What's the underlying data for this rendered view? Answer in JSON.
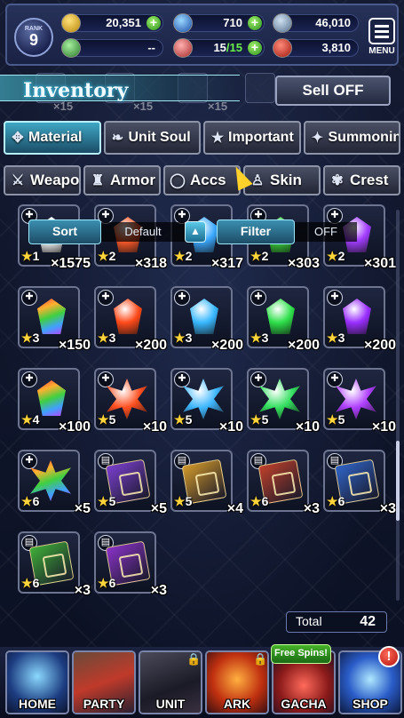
{
  "status_bar": {
    "rank_label": "RANK",
    "rank_value": "9",
    "gil": "20,351",
    "lapis": "710",
    "currency3": "46,010",
    "friend": "--",
    "energy_current": "15",
    "energy_max": "/15",
    "arena": "3,810",
    "menu_label": "MENU"
  },
  "header": {
    "title": "Inventory",
    "sell_label": "Sell OFF",
    "ghost_qty": "×15"
  },
  "tabs": {
    "row1": [
      "Material",
      "Unit Soul",
      "Important",
      "Summoning"
    ],
    "row2": [
      "Weapon",
      "Armor",
      "Accs",
      "Skin",
      "Crest"
    ],
    "active": "Material"
  },
  "sort_filter": {
    "sort_label": "Sort",
    "sort_value": "Default",
    "filter_label": "Filter",
    "filter_value": "OFF"
  },
  "items": [
    {
      "stars": "1",
      "qty": "×1575",
      "kind": "gem",
      "color": "#ffffff"
    },
    {
      "stars": "2",
      "qty": "×318",
      "kind": "gem",
      "color": "#ff5a2a"
    },
    {
      "stars": "2",
      "qty": "×317",
      "kind": "gem",
      "color": "#3aa8ff"
    },
    {
      "stars": "2",
      "qty": "×303",
      "kind": "gem",
      "color": "#39d13b"
    },
    {
      "stars": "2",
      "qty": "×301",
      "kind": "gem",
      "color": "#a23cff"
    },
    {
      "stars": "3",
      "qty": "×150",
      "kind": "gem",
      "color": "rainbow"
    },
    {
      "stars": "3",
      "qty": "×200",
      "kind": "gem",
      "color": "#ff4a1a"
    },
    {
      "stars": "3",
      "qty": "×200",
      "kind": "gem",
      "color": "#38b8ff"
    },
    {
      "stars": "3",
      "qty": "×200",
      "kind": "gem",
      "color": "#2ee04a"
    },
    {
      "stars": "3",
      "qty": "×200",
      "kind": "gem",
      "color": "#9a2eff"
    },
    {
      "stars": "4",
      "qty": "×100",
      "kind": "gem",
      "color": "rainbow"
    },
    {
      "stars": "5",
      "qty": "×10",
      "kind": "cluster",
      "color": "#ff5020"
    },
    {
      "stars": "5",
      "qty": "×10",
      "kind": "cluster",
      "color": "#40b8ff"
    },
    {
      "stars": "5",
      "qty": "×10",
      "kind": "cluster",
      "color": "#34e060"
    },
    {
      "stars": "5",
      "qty": "×10",
      "kind": "cluster",
      "color": "#b040ff"
    },
    {
      "stars": "6",
      "qty": "×5",
      "kind": "cluster",
      "color": "rainbow"
    },
    {
      "stars": "5",
      "qty": "×5",
      "kind": "book",
      "color": "#7b3fd0"
    },
    {
      "stars": "5",
      "qty": "×4",
      "kind": "book",
      "color": "#d49a2a"
    },
    {
      "stars": "6",
      "qty": "×3",
      "kind": "book",
      "color": "#c0402a"
    },
    {
      "stars": "6",
      "qty": "×3",
      "kind": "book",
      "color": "#2f64c8"
    },
    {
      "stars": "6",
      "qty": "×3",
      "kind": "book",
      "color": "#3fae38"
    },
    {
      "stars": "6",
      "qty": "×3",
      "kind": "book",
      "color": "#8a32c8"
    }
  ],
  "total": {
    "label": "Total",
    "value": "42"
  },
  "nav": {
    "items": [
      "HOME",
      "PARTY",
      "UNIT",
      "ARK",
      "GACHA",
      "SHOP"
    ],
    "free_spins": "Free Spins!",
    "shop_badge": "!"
  }
}
